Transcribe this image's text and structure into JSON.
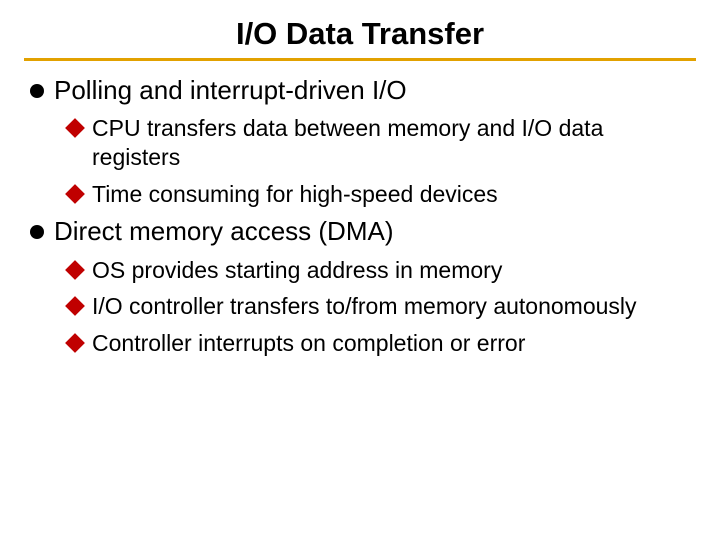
{
  "title": "I/O Data Transfer",
  "items": [
    {
      "text": "Polling and interrupt-driven I/O",
      "sub": [
        "CPU transfers data between memory and I/O data registers",
        "Time consuming for high-speed devices"
      ]
    },
    {
      "text": "Direct memory access (DMA)",
      "sub": [
        "OS provides starting address in memory",
        "I/O controller transfers to/from memory autonomously",
        "Controller interrupts on completion or error"
      ]
    }
  ]
}
